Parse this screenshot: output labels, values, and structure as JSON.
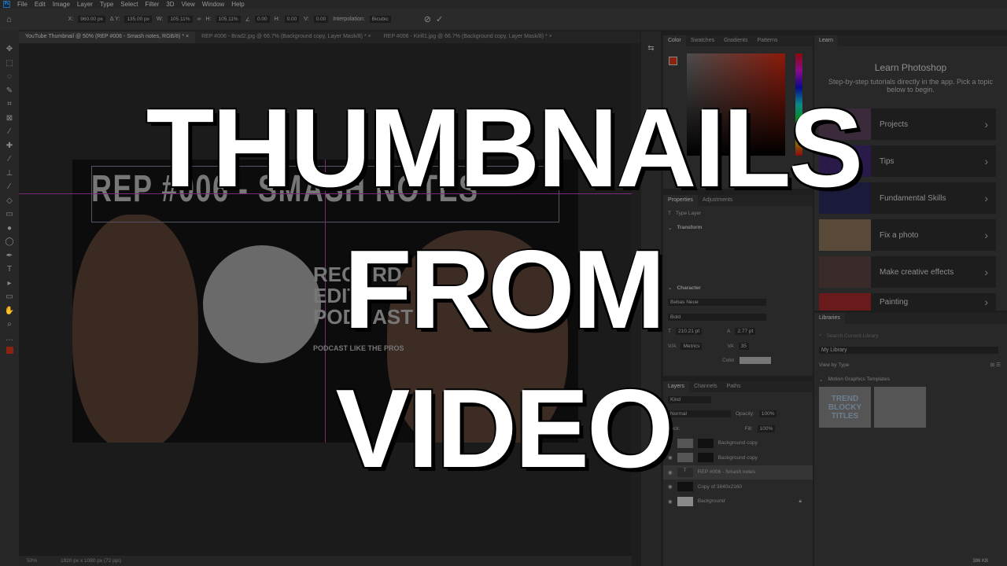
{
  "menu": [
    "File",
    "Edit",
    "Image",
    "Layer",
    "Type",
    "Select",
    "Filter",
    "3D",
    "View",
    "Window",
    "Help"
  ],
  "options": {
    "x": "960.00 px",
    "y": "135.00 px",
    "w": "105.11%",
    "h": "105.11%",
    "angle": "0.00",
    "hskew": "0.00",
    "vskew": "0.00",
    "interp_label": "Interpolation:",
    "interp": "Bicubic"
  },
  "tabs": [
    "YouTube Thumbnail @ 50% (REP #006 - Smash notes, RGB/8) *",
    "REP #006 - Brad2.jpg @ 66.7% (Background copy, Layer Mask/8) *",
    "REP #006 - Kirill1.jpg @ 66.7% (Background copy, Layer Mask/8) *"
  ],
  "doc": {
    "title": "REP #006 - SMASH NOTES",
    "pod": [
      "RECORD",
      "EDIT",
      "PODCAST"
    ],
    "pod_sub": "PODCAST LIKE THE PROS"
  },
  "status": {
    "zoom": "50%",
    "size": "1920 px x 1080 px (72 ppi)"
  },
  "color_tabs": [
    "Color",
    "Swatches",
    "Gradients",
    "Patterns"
  ],
  "props": {
    "tabs": [
      "Properties",
      "Adjustments"
    ],
    "type": "Type Layer",
    "transform": "Transform",
    "character": "Character",
    "font": "Bebas Neue",
    "style": "Bold",
    "size": "210.21 pt",
    "leading": "2.77 pt",
    "kerning": "Metrics",
    "tracking": "35",
    "color_label": "Color"
  },
  "layers": {
    "tabs": [
      "Layers",
      "Channels",
      "Paths"
    ],
    "kind": "Kind",
    "blend": "Normal",
    "opacity_label": "Opacity:",
    "opacity": "100%",
    "lock": "Lock:",
    "fill_label": "Fill:",
    "fill": "100%",
    "items": [
      "Background copy",
      "Background copy",
      "REP #006 - Smash notes",
      "Copy of 3840x2160",
      "Background"
    ]
  },
  "learn": {
    "tab": "Learn",
    "title": "Learn Photoshop",
    "desc": "Step-by-step tutorials directly in the app. Pick a topic below to begin.",
    "cards": [
      "Projects",
      "Tips",
      "Fundamental Skills",
      "Fix a photo",
      "Make creative effects",
      "Painting"
    ]
  },
  "libraries": {
    "tab": "Libraries",
    "search": "Search Current Library",
    "library": "My Library",
    "view": "View by Type",
    "section": "Motion Graphics Templates",
    "template": "TREND BLOCKY TITLES",
    "size": "396 KB"
  },
  "overlay": [
    "THUMBNAILS",
    "FROM",
    "VIDEO"
  ]
}
